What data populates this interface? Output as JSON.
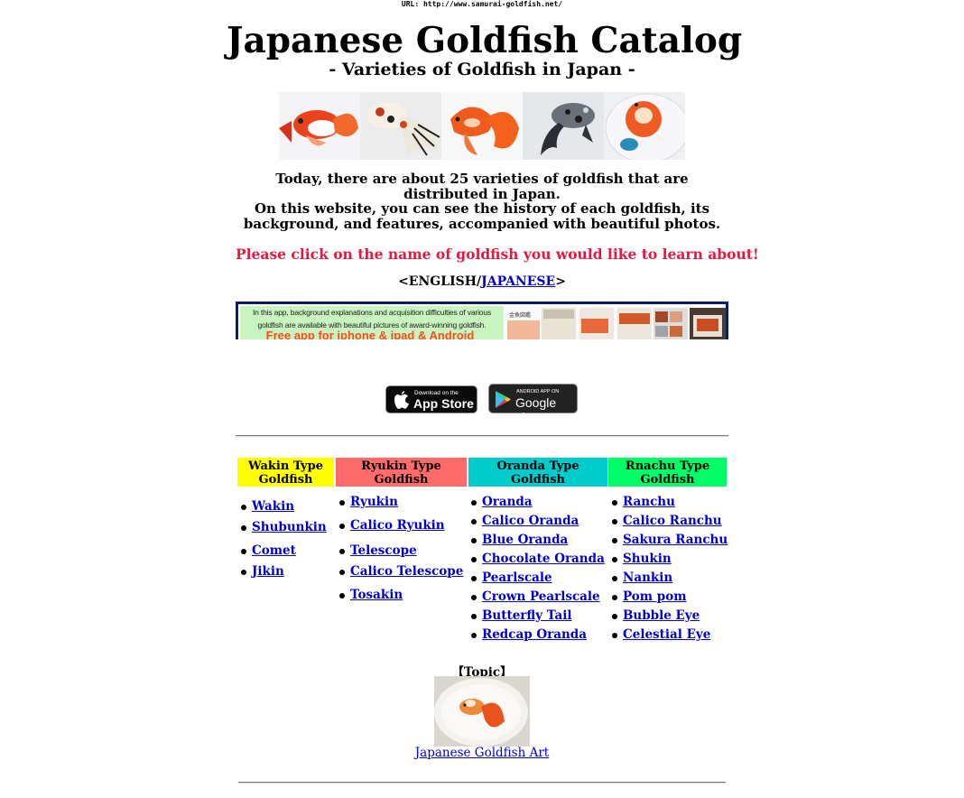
{
  "url_line": "URL: http://www.samurai-goldfish.net/",
  "header": {
    "title": "Japanese Goldfish Catalog",
    "subtitle": "- Varieties of Goldfish in Japan -"
  },
  "photos": [
    {
      "icon": "goldfish-photo-red-white"
    },
    {
      "icon": "goldfish-photo-calico-top"
    },
    {
      "icon": "goldfish-photo-red-fantail"
    },
    {
      "icon": "goldfish-photo-black-calico"
    },
    {
      "icon": "goldfish-photo-ranchu-bowl"
    }
  ],
  "intro": {
    "line1": "Today, there are about 25 varieties of goldfish that are distributed in Japan.",
    "line2": "On this website, you can see the history of each goldfish, its background, and features, accompanied with beautiful photos."
  },
  "call_to_action": "Please click on the name of goldfish you would like to learn about!",
  "language": {
    "prefix": "<ENGLISH/",
    "japanese_link": "JAPANESE",
    "suffix": ">"
  },
  "banner": {
    "text": "In this app, background explanations and acquisition difficulties of various goldfish are available with beautiful pictures of award-winning goldfish.",
    "free_line": "Free app for iphone & ipad & Android"
  },
  "app_buttons": {
    "app_store_small": "Download on the",
    "app_store_big": "App Store",
    "google_small": "ANDROID APP ON",
    "google_big": "Google play"
  },
  "colors": {
    "wakin": "#ffff00",
    "ryukin": "#ff6b6b",
    "oranda": "#00cccc",
    "ranchu": "#00ff66",
    "cta": "#e8173f",
    "link": "#0000cc"
  },
  "categories": [
    {
      "header": "Wakin Type Goldfish",
      "items": [
        "Wakin",
        "Shubunkin",
        "Comet",
        "Jikin"
      ]
    },
    {
      "header": "Ryukin Type Goldfish",
      "items": [
        "Ryukin",
        "Calico Ryukin",
        "Telescope",
        "Calico Telescope",
        "Tosakin"
      ]
    },
    {
      "header": "Oranda Type Goldfish",
      "items": [
        "Oranda",
        "Calico Oranda",
        "Blue Oranda",
        "Chocolate Oranda",
        "Pearlscale",
        "Crown Pearlscale",
        "Butterfly Tail",
        "Redcap Oranda"
      ]
    },
    {
      "header": "Rnachu Type Goldfish",
      "items": [
        "Ranchu",
        "Calico Ranchu",
        "Sakura Ranchu",
        "Shukin",
        "Nankin",
        "Pom pom",
        "Bubble Eye",
        "Celestial Eye"
      ]
    }
  ],
  "topic": {
    "label": "【Topic】",
    "link": "Japanese Goldfish Art"
  }
}
